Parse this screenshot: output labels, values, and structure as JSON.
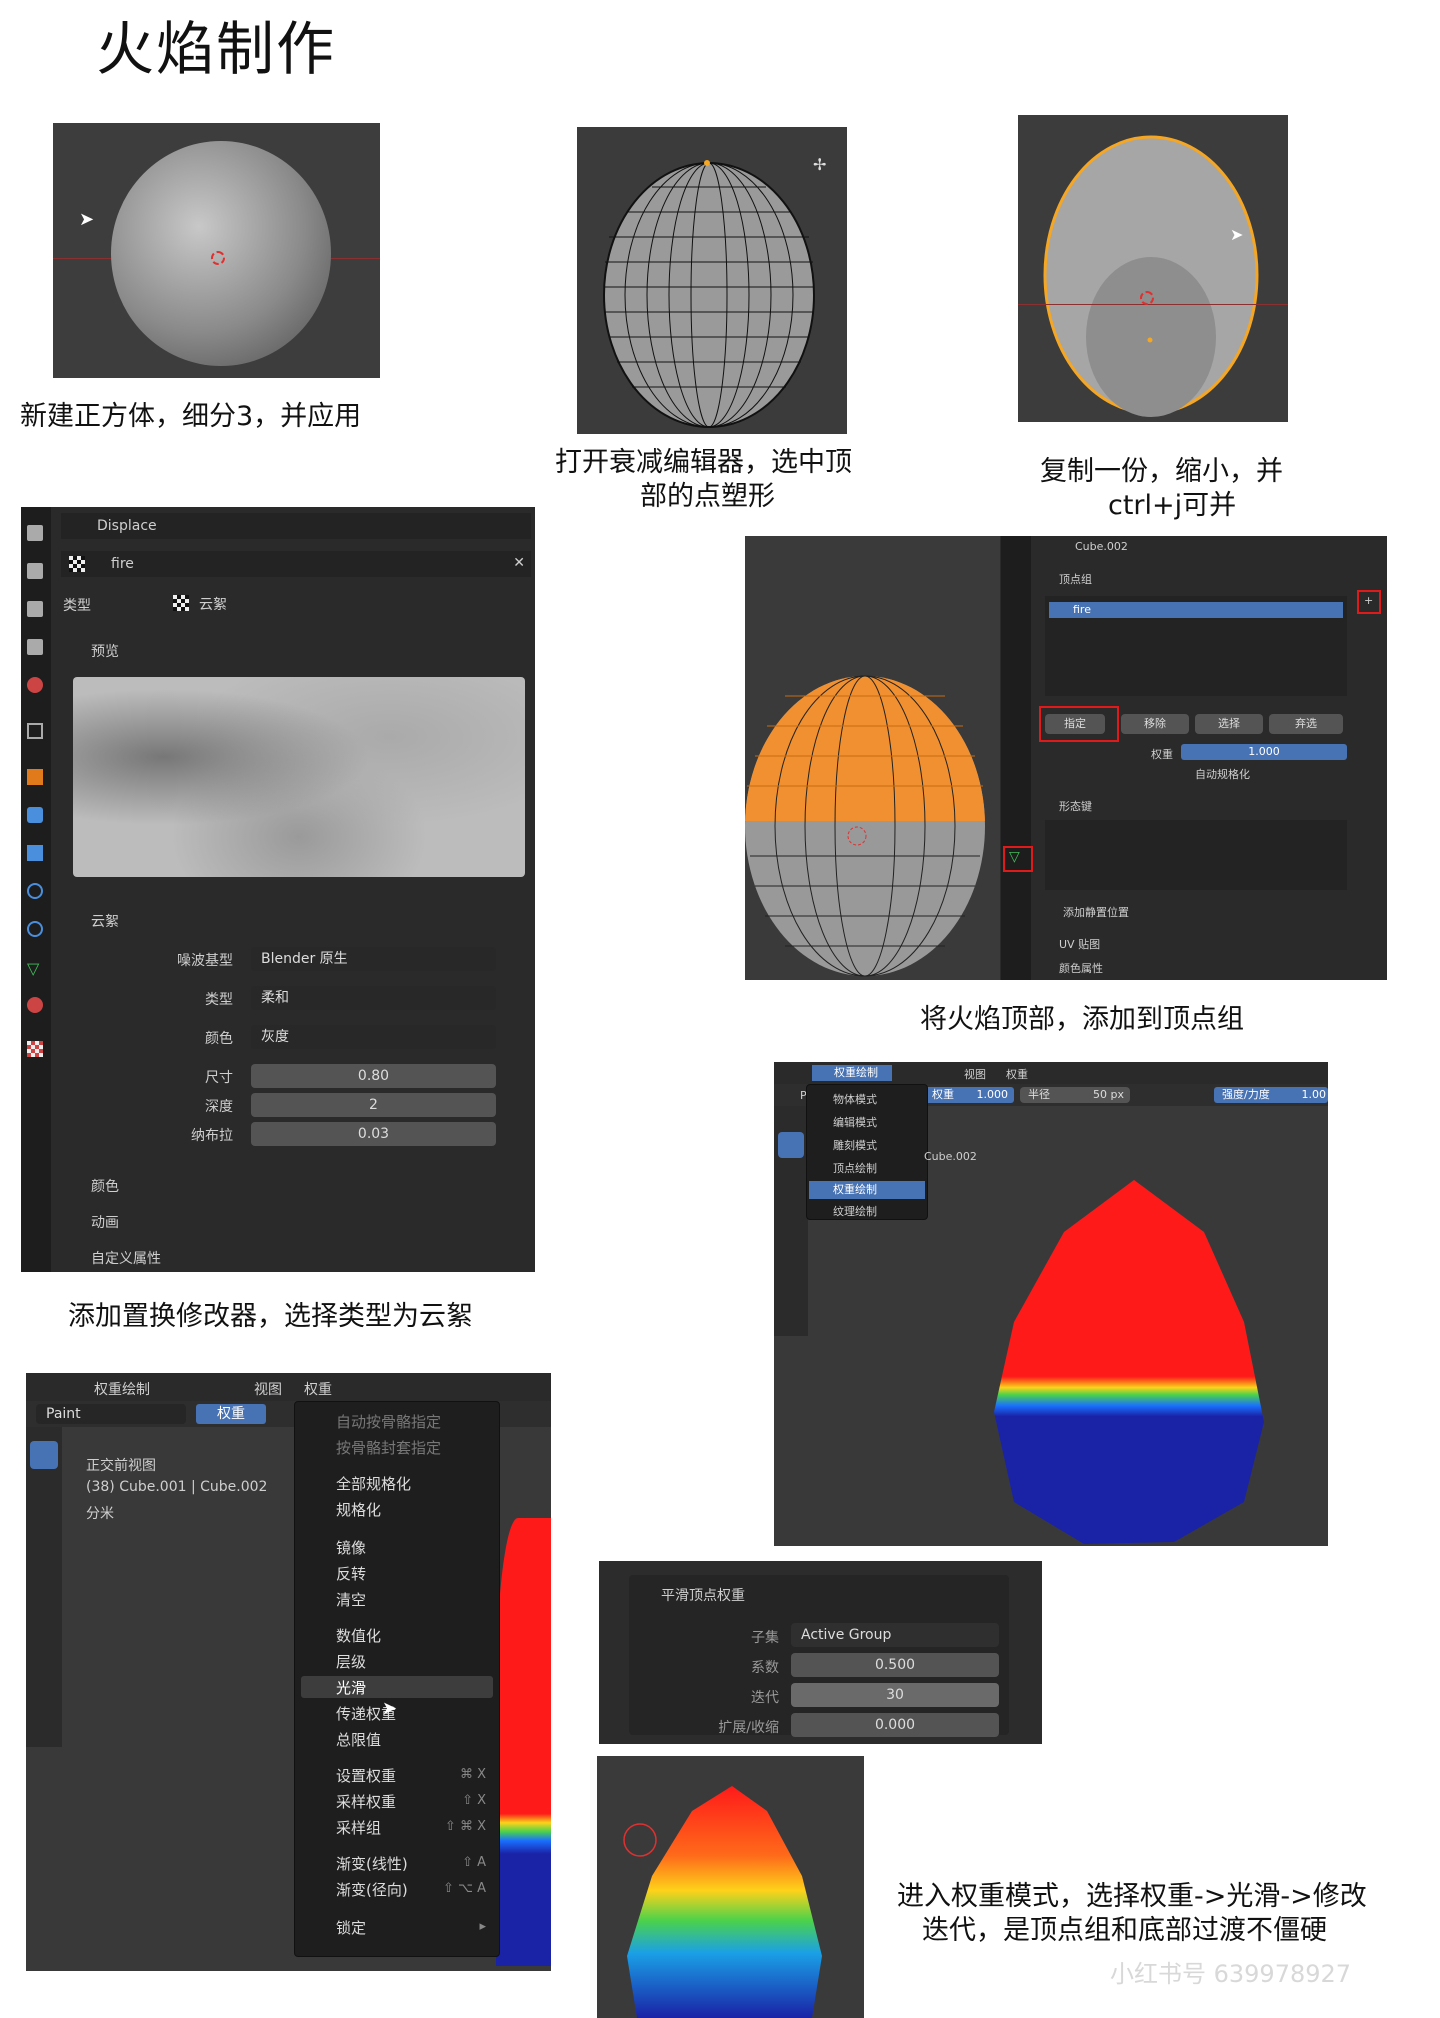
{
  "title": "火焰制作",
  "captions": {
    "c1": "新建正方体，细分3，并应用",
    "c2a": "打开衰减编辑器，选中顶",
    "c2b": "部的点塑形",
    "c3a": "复制一份，缩小，并",
    "c3b": "ctrl+j可并",
    "c4": "添加置换修改器，选择类型为云絮",
    "c5": "将火焰顶部，添加到顶点组",
    "c6a": "进入权重模式，选择权重->光滑->修改",
    "c6b": "迭代，是顶点组和底部过渡不僵硬",
    "watermark": "小红书号 639978927"
  },
  "displace": {
    "modifier": "Displace",
    "texture": "fire",
    "type_label": "类型",
    "type_value": "云絮",
    "preview": "预览",
    "clouds": "云絮",
    "rows": [
      {
        "label": "噪波基型",
        "value": "Blender 原生"
      },
      {
        "label": "类型",
        "value": "柔和"
      },
      {
        "label": "颜色",
        "value": "灰度"
      }
    ],
    "fields": [
      {
        "label": "尺寸",
        "value": "0.80"
      },
      {
        "label": "深度",
        "value": "2"
      },
      {
        "label": "纳布拉",
        "value": "0.03"
      }
    ],
    "sections": [
      "颜色",
      "动画",
      "自定义属性"
    ]
  },
  "vgroup": {
    "object": "Cube.002",
    "header": "顶点组",
    "group": "fire",
    "buttons": [
      "指定",
      "移除",
      "选择",
      "弃选"
    ],
    "weight_label": "权重",
    "weight_value": "1.000",
    "auto_normalize": "自动规格化",
    "shape_keys": "形态键",
    "add_rest": "添加静置位置",
    "uv": "UV 贴图",
    "color_attr": "颜色属性"
  },
  "wpaint": {
    "mode": "权重绘制",
    "view": "视图",
    "weight_menu": "权重",
    "weight_label": "权重",
    "weight_value": "1.000",
    "radius_label": "半径",
    "radius_value": "50 px",
    "strength_label": "强度/力度",
    "strength_value": "1.00",
    "object": "Cube.002",
    "modes": [
      "物体模式",
      "编辑模式",
      "雕刻模式",
      "顶点绘制",
      "权重绘制",
      "纹理绘制"
    ],
    "tool_left": "Pa"
  },
  "weightmenu": {
    "mode": "权重绘制",
    "view": "视图",
    "weight": "权重",
    "brush": "Paint",
    "weight_field": "权重",
    "info1": "正交前视图",
    "info2": "(38) Cube.001 | Cube.002",
    "info3": "分米",
    "items": [
      {
        "label": "自动按骨骼指定",
        "key": "",
        "dim": true
      },
      {
        "label": "按骨骼封套指定",
        "key": "",
        "dim": true
      },
      {
        "label": "全部规格化",
        "key": ""
      },
      {
        "label": "规格化",
        "key": ""
      },
      {
        "label": "镜像",
        "key": ""
      },
      {
        "label": "反转",
        "key": ""
      },
      {
        "label": "清空",
        "key": ""
      },
      {
        "label": "数值化",
        "key": ""
      },
      {
        "label": "层级",
        "key": ""
      },
      {
        "label": "光滑",
        "key": ""
      },
      {
        "label": "传递权重",
        "key": ""
      },
      {
        "label": "总限值",
        "key": ""
      },
      {
        "label": "设置权重",
        "key": "⌘ X"
      },
      {
        "label": "采样权重",
        "key": "⇧ X"
      },
      {
        "label": "采样组",
        "key": "⇧ ⌘ X"
      },
      {
        "label": "渐变(线性)",
        "key": "⇧ A"
      },
      {
        "label": "渐变(径向)",
        "key": "⇧ ⌥ A"
      },
      {
        "label": "锁定",
        "key": "▸"
      }
    ]
  },
  "smooth": {
    "header": "平滑顶点权重",
    "fields": [
      {
        "label": "子集",
        "value": "Active Group"
      },
      {
        "label": "系数",
        "value": "0.500"
      },
      {
        "label": "迭代",
        "value": "30"
      },
      {
        "label": "扩展/收缩",
        "value": "0.000"
      }
    ]
  },
  "colors": {
    "accent": "#4772b3",
    "orange": "#f5a623",
    "red": "#e01a1a"
  }
}
